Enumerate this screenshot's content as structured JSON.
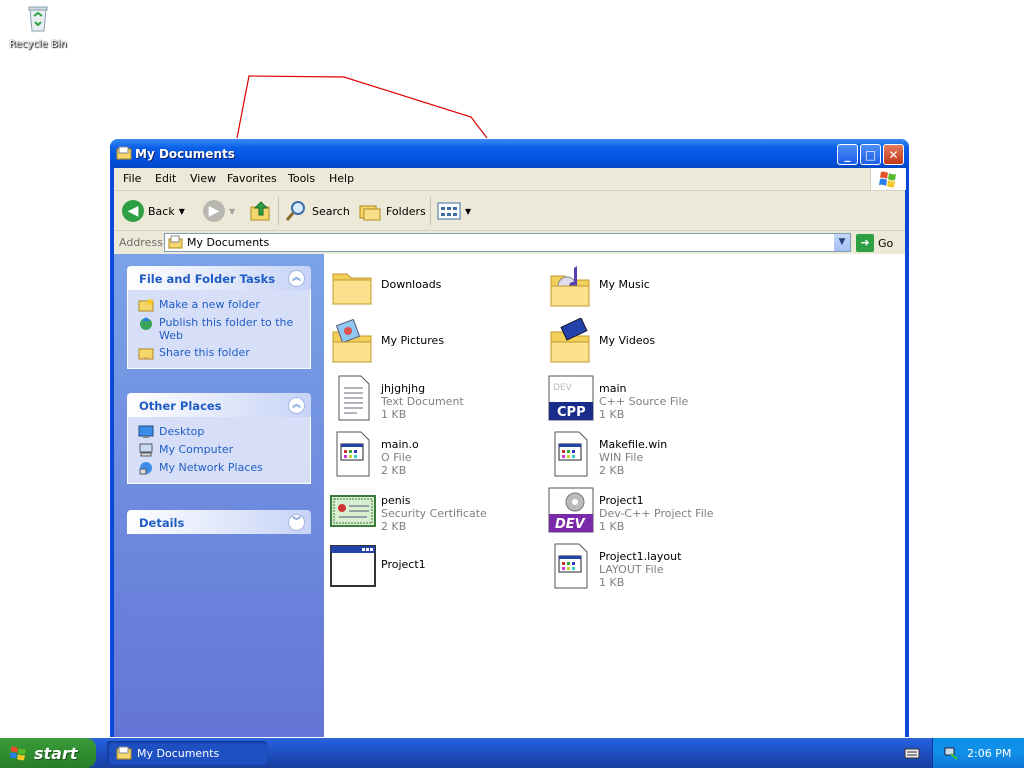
{
  "desktop": {
    "recycle_bin_label": "Recycle Bin"
  },
  "window": {
    "title": "My Documents",
    "menu": [
      "File",
      "Edit",
      "View",
      "Favorites",
      "Tools",
      "Help"
    ],
    "toolbar": {
      "back_label": "Back",
      "search_label": "Search",
      "folders_label": "Folders"
    },
    "address": {
      "label": "Address",
      "value": "My Documents",
      "go_label": "Go"
    }
  },
  "taskpane": {
    "file_folder_tasks": {
      "title": "File and Folder Tasks",
      "items": [
        {
          "label": "Make a new folder",
          "icon": "new-folder-icon"
        },
        {
          "label": "Publish this folder to the Web",
          "icon": "publish-web-icon"
        },
        {
          "label": "Share this folder",
          "icon": "share-folder-icon"
        }
      ]
    },
    "other_places": {
      "title": "Other Places",
      "items": [
        {
          "label": "Desktop",
          "icon": "desktop-icon"
        },
        {
          "label": "My Computer",
          "icon": "my-computer-icon"
        },
        {
          "label": "My Network Places",
          "icon": "network-places-icon"
        }
      ]
    },
    "details": {
      "title": "Details"
    }
  },
  "files": [
    {
      "name": "Downloads",
      "type": "",
      "size": "",
      "icon": "folder-icon"
    },
    {
      "name": "My Music",
      "type": "",
      "size": "",
      "icon": "music-folder-icon"
    },
    {
      "name": "My Pictures",
      "type": "",
      "size": "",
      "icon": "pictures-folder-icon"
    },
    {
      "name": "My Videos",
      "type": "",
      "size": "",
      "icon": "videos-folder-icon"
    },
    {
      "name": "jhjghjhg",
      "type": "Text Document",
      "size": "1 KB",
      "icon": "text-document-icon"
    },
    {
      "name": "main",
      "type": "C++ Source File",
      "size": "1 KB",
      "icon": "cpp-file-icon"
    },
    {
      "name": "main.o",
      "type": "O File",
      "size": "2 KB",
      "icon": "generic-file-icon"
    },
    {
      "name": "Makefile.win",
      "type": "WIN File",
      "size": "2 KB",
      "icon": "generic-file-icon"
    },
    {
      "name": "penis",
      "type": "Security Certificate",
      "size": "2 KB",
      "icon": "certificate-icon"
    },
    {
      "name": "Project1",
      "type": "Dev-C++ Project File",
      "size": "1 KB",
      "icon": "devcpp-project-icon"
    },
    {
      "name": "Project1",
      "type": "",
      "size": "",
      "icon": "application-icon"
    },
    {
      "name": "Project1.layout",
      "type": "LAYOUT File",
      "size": "1 KB",
      "icon": "generic-file-icon"
    }
  ],
  "taskbar": {
    "start_label": "start",
    "task_item_label": "My Documents",
    "clock": "2:06 PM"
  },
  "colors": {
    "title_bar": "#0a5fe8",
    "taskpane_link": "#215dc6",
    "start_button": "#2f8f2f",
    "taskbar": "#245edb"
  }
}
